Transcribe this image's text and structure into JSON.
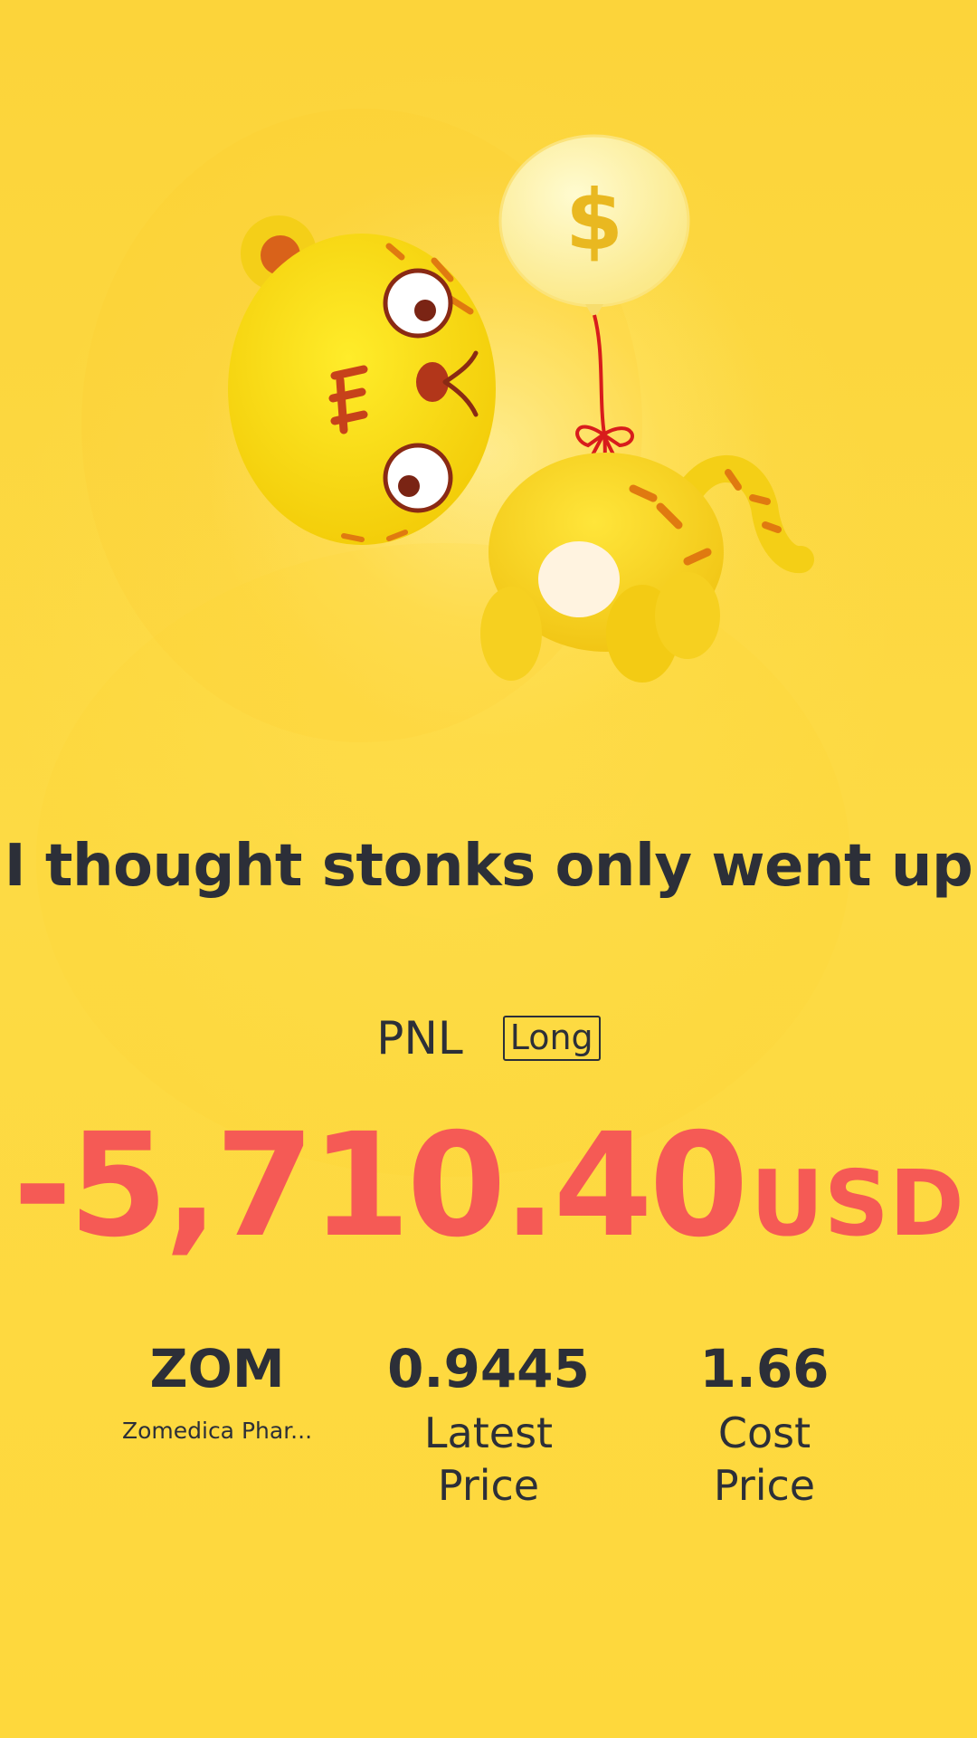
{
  "headline": "I thought stonks only went up",
  "pnl": {
    "label": "PNL",
    "direction": "Long",
    "amount": "-5,710.40",
    "currency": "USD"
  },
  "stats": {
    "symbol": "ZOM",
    "company": "Zomedica Phar...",
    "latest_price": "0.9445",
    "latest_price_label_line1": "Latest",
    "latest_price_label_line2": "Price",
    "cost_price": "1.66",
    "cost_price_label_line1": "Cost",
    "cost_price_label_line2": "Price"
  },
  "illustration": {
    "icon": "tiger-with-dollar-balloon-icon",
    "balloon_symbol": "$"
  },
  "colors": {
    "background": "#fdd63a",
    "loss": "#f55a55",
    "text": "#2c2f38"
  }
}
